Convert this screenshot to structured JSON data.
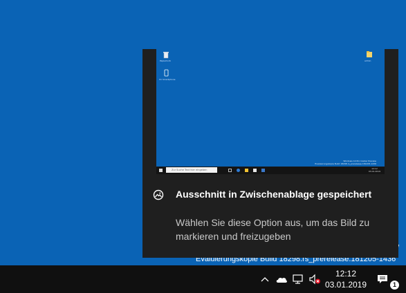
{
  "desktop": {
    "watermark_fragment": "ew",
    "build_text": "Evaluierungskopie Build 18298.rs_prerelease.181205-1436"
  },
  "toast": {
    "app_icon": "snip-sketch-icon",
    "title": "Ausschnitt in Zwischenablage gespeichert",
    "body": "Wählen Sie diese Option aus, um das Bild zu markieren und freizugeben",
    "preview": {
      "desktop_icons": [
        {
          "icon": "recycle-bin-icon",
          "label": "Papierkorb"
        },
        {
          "icon": "phone-link-icon",
          "label": "Ihr Smartphone"
        },
        {
          "icon": "folder-icon",
          "label": "admin"
        }
      ],
      "search_placeholder": "Zur Suche Text hier eingeben",
      "watermark_lines": [
        "Windows 10 Pro Insider Preview",
        "Evaluierungskopie Build 18298.rs_prerelease.181205-1436"
      ],
      "clock_time": "12:12",
      "clock_date": "03.01.2019"
    }
  },
  "taskbar": {
    "tray_icons": [
      "chevron-up-icon",
      "onedrive-cloud-icon",
      "network-icon",
      "volume-muted-icon"
    ],
    "clock_time": "12:12",
    "clock_date": "03.01.2019",
    "notification_count": "1",
    "action_center_icon": "action-center-icon"
  }
}
